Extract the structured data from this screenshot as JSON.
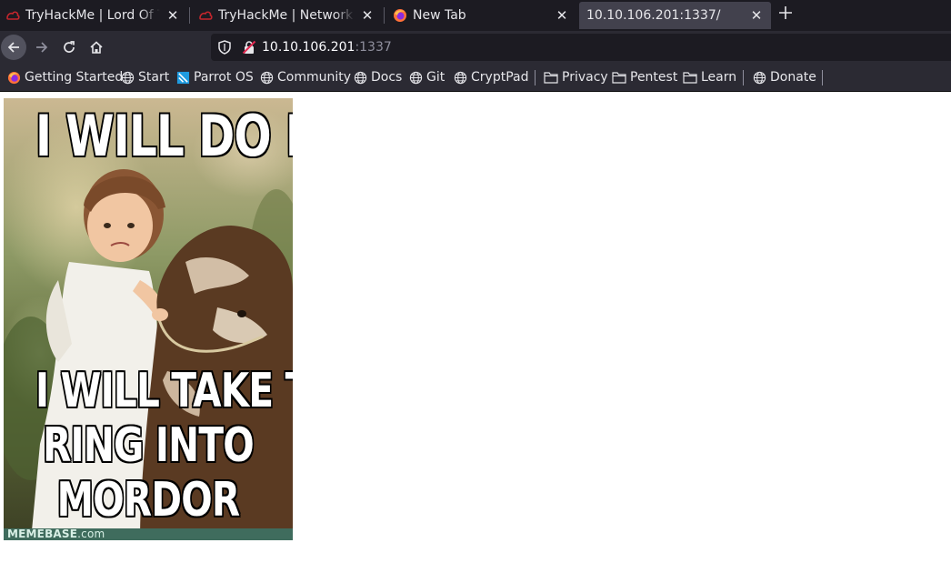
{
  "tabs": [
    {
      "title": "TryHackMe | Lord Of The Root",
      "favicon": "tryhackme-icon",
      "active": false
    },
    {
      "title": "TryHackMe | Network Access",
      "favicon": "tryhackme-icon",
      "active": false
    },
    {
      "title": "New Tab",
      "favicon": "firefox-icon",
      "active": false
    },
    {
      "title": "10.10.106.201:1337/",
      "favicon": "",
      "active": true
    }
  ],
  "url": {
    "host": "10.10.106.201",
    "port": ":1337"
  },
  "bookmarks": [
    {
      "label": "Getting Started",
      "icon": "firefox-icon"
    },
    {
      "label": "Start",
      "icon": "globe-icon"
    },
    {
      "label": "Parrot OS",
      "icon": "parrot-icon"
    },
    {
      "label": "Community",
      "icon": "globe-icon"
    },
    {
      "label": "Docs",
      "icon": "globe-icon"
    },
    {
      "label": "Git",
      "icon": "globe-icon"
    },
    {
      "label": "CryptPad",
      "icon": "globe-icon"
    },
    {
      "label": "Privacy",
      "icon": "folder-icon"
    },
    {
      "label": "Pentest",
      "icon": "folder-icon"
    },
    {
      "label": "Learn",
      "icon": "folder-icon"
    },
    {
      "label": "Donate",
      "icon": "globe-icon"
    }
  ],
  "meme": {
    "top_text": "I WILL DO IT",
    "bottom_line1": "I WILL TAKE THE",
    "bottom_line2": "RING INTO",
    "bottom_line3": "MORDOR",
    "footer_brand": "MEMEBASE",
    "footer_suffix": ".com"
  },
  "colors": {
    "tabstrip": "#1c1b22",
    "toolbar": "#2b2a33",
    "active_tab": "#42414d",
    "accent_red": "#e22850"
  }
}
